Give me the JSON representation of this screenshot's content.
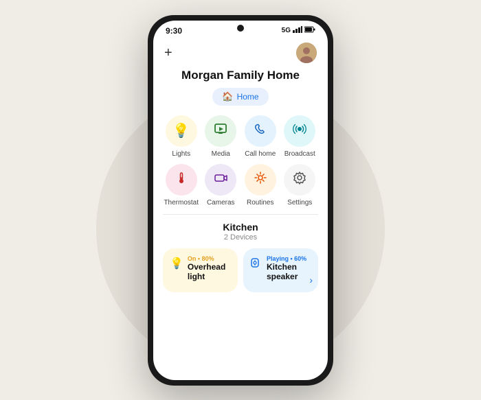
{
  "background": {
    "color": "#f0ede6"
  },
  "status_bar": {
    "time": "9:30",
    "network": "5G",
    "signal": "full",
    "battery": "full"
  },
  "top_bar": {
    "add_label": "+",
    "avatar_alt": "User avatar"
  },
  "home_title": "Morgan Family Home",
  "home_chip": {
    "label": "Home",
    "icon": "🏠"
  },
  "quick_actions_row1": [
    {
      "id": "lights",
      "label": "Lights",
      "icon": "💡",
      "bg": "#fff8e1",
      "icon_color": "#e6a020"
    },
    {
      "id": "media",
      "label": "Media",
      "icon": "📺",
      "bg": "#e8f5e9",
      "icon_color": "#2e7d32"
    },
    {
      "id": "call_home",
      "label": "Call home",
      "icon": "📞",
      "bg": "#e3f2fd",
      "icon_color": "#1565c0"
    },
    {
      "id": "broadcast",
      "label": "Broadcast",
      "icon": "📢",
      "bg": "#e0f7fa",
      "icon_color": "#00838f"
    }
  ],
  "quick_actions_row2": [
    {
      "id": "thermostat",
      "label": "Thermostat",
      "icon": "🌡️",
      "bg": "#fce4ec",
      "icon_color": "#c62828"
    },
    {
      "id": "cameras",
      "label": "Cameras",
      "icon": "📹",
      "bg": "#ede7f6",
      "icon_color": "#6a1b9a"
    },
    {
      "id": "routines",
      "label": "Routines",
      "icon": "✨",
      "bg": "#fff3e0",
      "icon_color": "#e65100"
    },
    {
      "id": "settings",
      "label": "Settings",
      "icon": "⚙️",
      "bg": "#f5f5f5",
      "icon_color": "#555"
    }
  ],
  "room": {
    "name": "Kitchen",
    "device_count": "2 Devices"
  },
  "devices": [
    {
      "id": "overhead_light",
      "status": "On • 80%",
      "name": "Overhead light",
      "icon": "💡",
      "type": "warm"
    },
    {
      "id": "kitchen_speaker",
      "status": "Playing • 60%",
      "name": "Kitchen speaker",
      "icon": "🔊",
      "type": "cool"
    }
  ]
}
